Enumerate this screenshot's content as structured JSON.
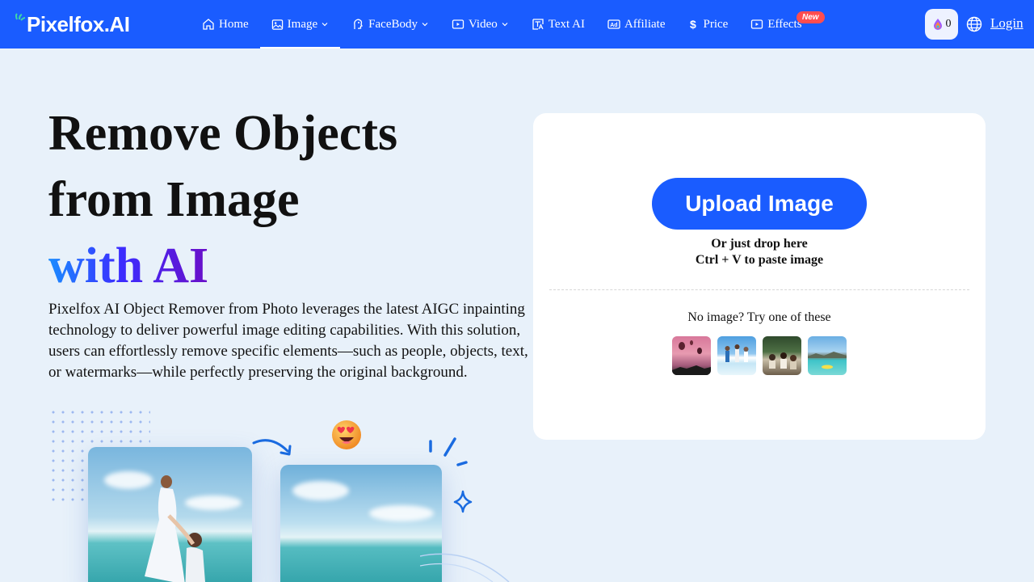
{
  "nav": {
    "brand": "Pixelfox.AI",
    "items": [
      {
        "label": "Home",
        "icon": "home-icon"
      },
      {
        "label": "Image",
        "icon": "image-icon",
        "dropdown": true,
        "active": true
      },
      {
        "label": "FaceBody",
        "icon": "face-body-icon",
        "dropdown": true
      },
      {
        "label": "Video",
        "icon": "video-icon",
        "dropdown": true
      },
      {
        "label": "Text AI",
        "icon": "text-ai-icon"
      },
      {
        "label": "Affiliate",
        "icon": "ad-icon"
      },
      {
        "label": "Price",
        "icon": "dollar-icon"
      },
      {
        "label": "Effects",
        "icon": "play-icon",
        "badge": "New"
      }
    ],
    "credits": "0",
    "login": "Login",
    "colors": {
      "bar": "#1a5cff",
      "badge": "#ff4d4f"
    }
  },
  "hero": {
    "title_line1": "Remove Objects",
    "title_line2": "from Image",
    "title_line3": "with AI",
    "description": "Pixelfox AI Object Remover from Photo leverages the latest AIGC inpainting technology to deliver powerful image editing capabilities. With this solution, users can effortlessly remove specific elements—such as people, objects, text, or watermarks—while perfectly preserving the original background."
  },
  "upload": {
    "button_label": "Upload Image",
    "drop_hint": "Or just drop here",
    "paste_hint": "Ctrl + V to paste image",
    "sample_prompt": "No image? Try one of these",
    "samples": [
      "balloons-sample",
      "beach-people-sample",
      "group-park-sample",
      "sea-boat-sample"
    ]
  }
}
